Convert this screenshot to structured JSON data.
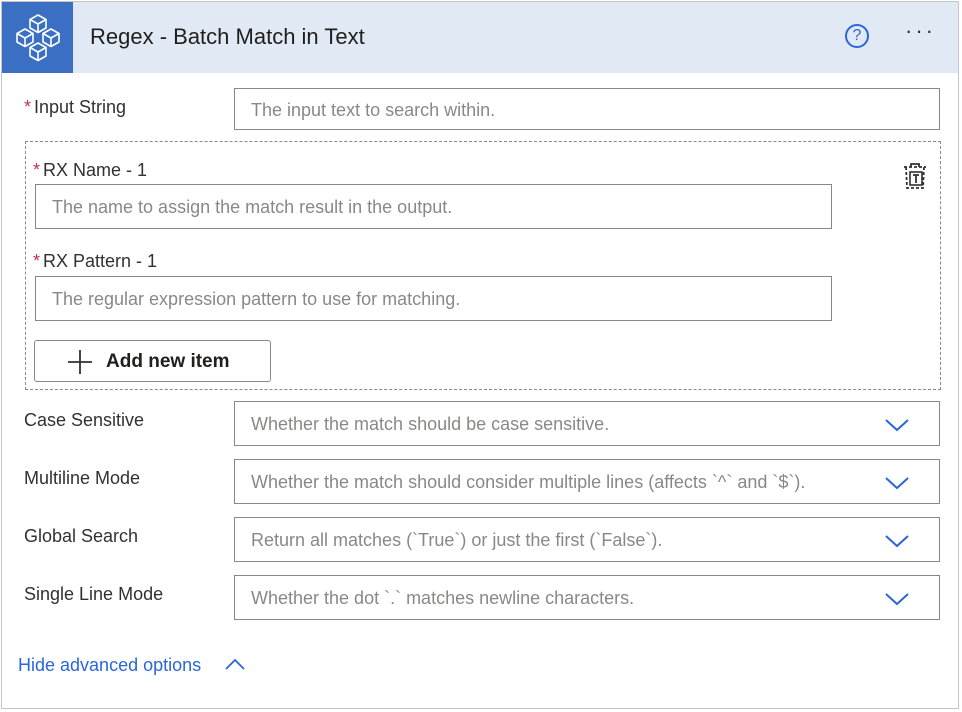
{
  "header": {
    "title": "Regex - Batch Match in Text",
    "logo_icon": "connector-cubes-icon",
    "help_label": "?",
    "more_label": "···",
    "accent": "#3b6fc4",
    "background": "#e1e9f5"
  },
  "input_string": {
    "required_mark": "*",
    "label": "Input String",
    "placeholder": "The input text to search within."
  },
  "rx_item": {
    "name_required_mark": "*",
    "name_label": "RX Name - 1",
    "name_placeholder": "The name to assign the match result in the output.",
    "pattern_required_mark": "*",
    "pattern_label": "RX Pattern - 1",
    "pattern_placeholder": "The regular expression pattern to use for matching.",
    "remove_icon": "delete-item-icon"
  },
  "add_item": {
    "label": "Add new item"
  },
  "options": [
    {
      "label": "Case Sensitive",
      "placeholder": "Whether the match should be case sensitive."
    },
    {
      "label": "Multiline Mode",
      "placeholder": "Whether the match should consider multiple lines (affects `^` and `$`)."
    },
    {
      "label": "Global Search",
      "placeholder": "Return all matches (`True`) or just the first (`False`)."
    },
    {
      "label": "Single Line Mode",
      "placeholder": "Whether the dot `.` matches newline characters."
    }
  ],
  "advanced": {
    "label": "Hide advanced options"
  },
  "colors": {
    "link": "#2b66d8",
    "required": "#c4314b",
    "border": "#8a8886"
  }
}
